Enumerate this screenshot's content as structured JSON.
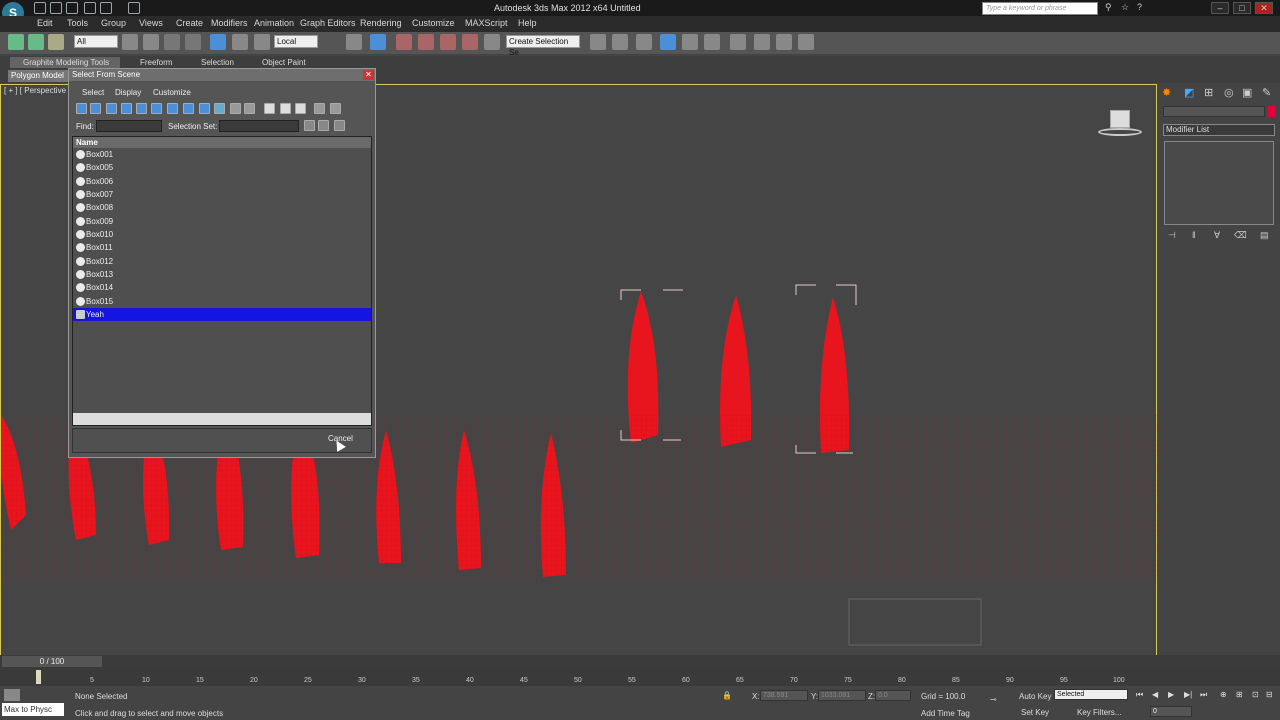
{
  "window": {
    "title": "Autodesk 3ds Max  2012 x64     Untitled",
    "search_placeholder": "Type a keyword or phrase"
  },
  "menubar": [
    "Edit",
    "Tools",
    "Group",
    "Views",
    "Create",
    "Modifiers",
    "Animation",
    "Graph Editors",
    "Rendering",
    "Customize",
    "MAXScript",
    "Help"
  ],
  "toolbar": {
    "filter": "All",
    "coord": "Local",
    "selection_set": "Create Selection Se"
  },
  "ribbon": {
    "tabs": [
      "Graphite Modeling Tools",
      "Freeform",
      "Selection",
      "Object Paint"
    ],
    "panel": "Polygon Model"
  },
  "viewport": {
    "label": "[ + ] [ Perspective ]"
  },
  "command_panel": {
    "modifier_list": "Modifier List"
  },
  "dialog": {
    "title": "Select From Scene",
    "menu": [
      "Select",
      "Display",
      "Customize"
    ],
    "find_label": "Find:",
    "selection_set_label": "Selection Set:",
    "column": "Name",
    "items": [
      "Box001",
      "Box005",
      "Box006",
      "Box007",
      "Box008",
      "Box009",
      "Box010",
      "Box011",
      "Box012",
      "Box013",
      "Box014",
      "Box015",
      "Yeah"
    ],
    "selected": "Yeah",
    "cancel": "Cancel"
  },
  "timeline": {
    "frame": "0 / 100",
    "ticks": [
      "0",
      "5",
      "10",
      "15",
      "20",
      "25",
      "30",
      "35",
      "40",
      "45",
      "50",
      "55",
      "60",
      "65",
      "70",
      "75",
      "80",
      "85",
      "90",
      "95",
      "100"
    ]
  },
  "status": {
    "maxscript": "Max to Physc",
    "selected": "None Selected",
    "prompt": "Click and drag to select and move objects",
    "x_label": "X:",
    "x_value": "738.591",
    "y_label": "Y:",
    "y_value": "1033.081",
    "z_label": "Z:",
    "z_value": "0.0",
    "grid": "Grid = 100.0",
    "autokey": "Auto Key",
    "autokey_value": "Selected",
    "setkey": "Set Key",
    "keyfilters": "Key Filters...",
    "addtimetag": "Add Time Tag",
    "frame_value": "0"
  }
}
